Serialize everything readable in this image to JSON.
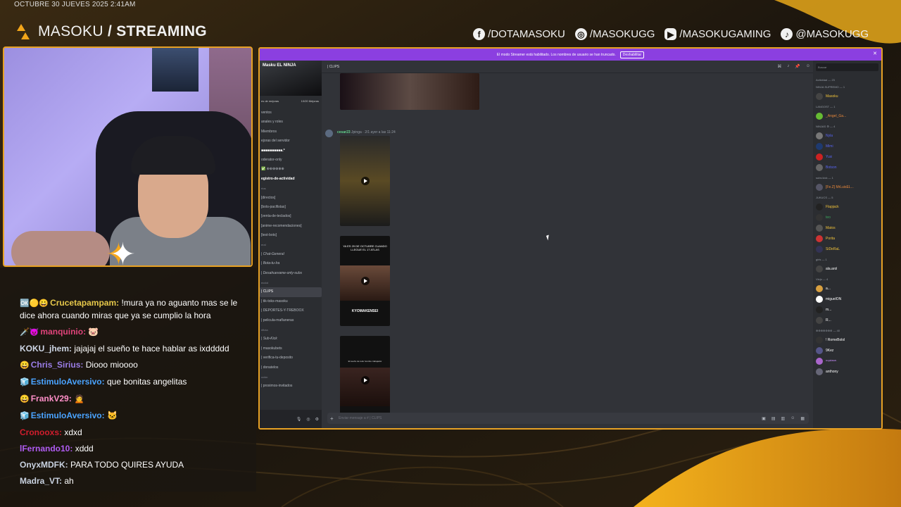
{
  "overlay": {
    "date": "OCTUBRE 30 JUEVES 2025 2:41AM",
    "brand_light": "MASOKU",
    "brand_bold": "/ STREAMING",
    "socials": [
      {
        "icon": "facebook-icon",
        "glyph": "f",
        "label": "/DOTAMASOKU"
      },
      {
        "icon": "instagram-icon",
        "glyph": "◎",
        "label": "/MASOKUGG"
      },
      {
        "icon": "youtube-icon",
        "glyph": "▶",
        "label": "/MASOKUGAMING"
      },
      {
        "icon": "tiktok-icon",
        "glyph": "♪",
        "label": "@MASOKUGG"
      }
    ]
  },
  "chat": [
    {
      "badges": "🆗🟡😀",
      "user": "Crucetapampam:",
      "color": "#e6c84a",
      "text": "!mura ya no aguanto mas se le dice ahora cuando miras que ya se cumplio la hora"
    },
    {
      "badges": "🗡️😈",
      "user": "manquinio:",
      "color": "#e0437a",
      "text": "🐷"
    },
    {
      "badges": "",
      "user": "KOKU_jhem:",
      "color": "#cfd7e6",
      "text": "jajajaj el sueño te hace hablar as ixddddd"
    },
    {
      "badges": "😀",
      "user": "Chris_Sirius:",
      "color": "#9b7ee8",
      "text": "Diooo mioooo"
    },
    {
      "badges": "🧊",
      "user": "EstimuloAversivo:",
      "color": "#4aa3ff",
      "text": "que bonitas angelitas"
    },
    {
      "badges": "😀",
      "user": "FrankV29:",
      "color": "#ff8fc8",
      "text": "🙍"
    },
    {
      "badges": "🧊",
      "user": "EstimuloAversivo:",
      "color": "#4aa3ff",
      "text": "🐱"
    },
    {
      "badges": "",
      "user": "Cronooxs:",
      "color": "#d11d2d",
      "text": "xdxd"
    },
    {
      "badges": "",
      "user": "lFernando10:",
      "color": "#b05cf2",
      "text": "xddd"
    },
    {
      "badges": "",
      "user": "OnyxMDFK:",
      "color": "#c9d2e0",
      "text": "PARA TODO QUIRES AYUDA"
    },
    {
      "badges": "",
      "user": "Madra_VT:",
      "color": "#c9d2e0",
      "text": "ah"
    }
  ],
  "discord": {
    "banner_text": "El modo Streamer está habilitado. Los nombres de usuario se han truncado.",
    "banner_button": "Deshabilitar",
    "server_name": "Masku EL NINJA",
    "boost_left": "es de mejoras",
    "boost_right": "10/20 Mejoras",
    "channels": [
      {
        "label": "ventos",
        "kind": "normal"
      },
      {
        "label": "anales y roles",
        "kind": "normal"
      },
      {
        "label": "Miembros",
        "kind": "normal"
      },
      {
        "label": "ejoras del servidor",
        "kind": "normal"
      },
      {
        "label": "■■■■■■■■■■.*",
        "kind": "bold"
      },
      {
        "label": "oderator-only",
        "kind": "normal"
      },
      {
        "label": "✅ ⊕⊕⊕⊕⊕⊕",
        "kind": "normal"
      },
      {
        "label": "egistro-de-actividad",
        "kind": "bold"
      },
      {
        "label": "rtos",
        "kind": "cat"
      },
      {
        "label": "[directos]",
        "kind": "normal"
      },
      {
        "label": "[bots-pacifistas]",
        "kind": "normal"
      },
      {
        "label": "[venta-de-teclados]",
        "kind": "normal"
      },
      {
        "label": "[anime-recomendaciones]",
        "kind": "normal"
      },
      {
        "label": "[test-bots]",
        "kind": "normal"
      },
      {
        "label": "eral",
        "kind": "cat"
      },
      {
        "label": "| Chat-General",
        "kind": "it"
      },
      {
        "label": "| Bota-tu-Ira",
        "kind": "it"
      },
      {
        "label": "| Desahuevame-only-subs",
        "kind": "it"
      },
      {
        "label": "ecciol",
        "kind": "cat"
      },
      {
        "label": "| CLIPS",
        "kind": "active"
      },
      {
        "label": "| tik-toks-masoku",
        "kind": "normal"
      },
      {
        "label": "| DEPORTES-Y-TREBOOX",
        "kind": "normal"
      },
      {
        "label": "| pelicula-mañaneras",
        "kind": "normal"
      },
      {
        "label": "rificta",
        "kind": "cat"
      },
      {
        "label": "| Sub-Kick",
        "kind": "it"
      },
      {
        "label": "| masokubets",
        "kind": "normal"
      },
      {
        "label": "| verifica-tu-deposito",
        "kind": "normal"
      },
      {
        "label": "| donatelos",
        "kind": "normal"
      },
      {
        "label": "cción",
        "kind": "cat"
      },
      {
        "label": "| proximos-invitados",
        "kind": "normal"
      }
    ],
    "header": {
      "channel": "| CLIPS"
    },
    "search_placeholder": "Buscar",
    "post_author": "cesar23",
    "post_meta": "Jpinga · 2/1 ayer a las 11:24",
    "composer_placeholder": "Enviar mensaje a # | CLIPS",
    "video_caption_1": "YA ES 29 DE OCTUBRE CUANDO LLEGUE EL 17 ATLAS",
    "video_caption_2": "KYOMAKENSEI",
    "video_caption_3": "El sueño de todo hombre trabajador",
    "members_header": "Actividad — 23",
    "member_groups": [
      {
        "title": "NINJA SUPREMO — 1",
        "members": [
          {
            "name": "Masoku",
            "color": "#f0c23a",
            "av": "#444"
          }
        ]
      },
      {
        "title": "LANGOST — 1",
        "members": [
          {
            "name": "_Angel_Ga...",
            "color": "#e8883a",
            "av": "#6b3"
          }
        ]
      },
      {
        "title": "NINJAS ⚙ — 4",
        "members": [
          {
            "name": "Nyla",
            "color": "#5865f2",
            "av": "#777"
          },
          {
            "name": "Mimi",
            "color": "#5865f2",
            "av": "#1e3a70"
          },
          {
            "name": "Yusi",
            "color": "#5865f2",
            "av": "#c22"
          },
          {
            "name": "Botson",
            "color": "#5865f2",
            "av": "#666"
          }
        ]
      },
      {
        "title": "subs kick — 1",
        "members": [
          {
            "name": "[Fe.Z] MrLuisEL...",
            "color": "#e8883a",
            "av": "#556"
          }
        ]
      },
      {
        "title": "JUKUCS — 5",
        "members": [
          {
            "name": "Flapjack",
            "color": "#f0c23a",
            "av": "#222"
          },
          {
            "name": "teo",
            "color": "#3ba55c",
            "av": "#333"
          },
          {
            "name": "Matos",
            "color": "#f0c23a",
            "av": "#555"
          },
          {
            "name": "Porita",
            "color": "#f0c23a",
            "av": "#c33"
          },
          {
            "name": "SiDeRaL",
            "color": "#f0c23a",
            "av": "#335"
          }
        ]
      },
      {
        "title": "girls — 1",
        "members": [
          {
            "name": "ala.arol",
            "color": "#fff",
            "av": "#444"
          }
        ]
      },
      {
        "title": "Viejo — 4",
        "members": [
          {
            "name": "a...",
            "color": "#fff",
            "av": "#d9a040"
          },
          {
            "name": "miguelON",
            "color": "#fff",
            "av": "#fff"
          },
          {
            "name": "m...",
            "color": "#fff",
            "av": "#222"
          },
          {
            "name": "R...",
            "color": "#fff",
            "av": "#444"
          }
        ]
      },
      {
        "title": "⊕⊕⊕⊕⊕⊕⊕ — 40",
        "members": [
          {
            "name": "! RomeBolol",
            "color": "#fff",
            "av": "#333"
          },
          {
            "name": "9Kez",
            "color": "#fff",
            "av": "#558"
          },
          {
            "name": "ᵃⁿᵍᵉˡᵃᵉᵛᵉ",
            "color": "#c58af9",
            "av": "#a6c"
          },
          {
            "name": "anthony",
            "color": "#fff",
            "av": "#667"
          }
        ]
      }
    ]
  }
}
